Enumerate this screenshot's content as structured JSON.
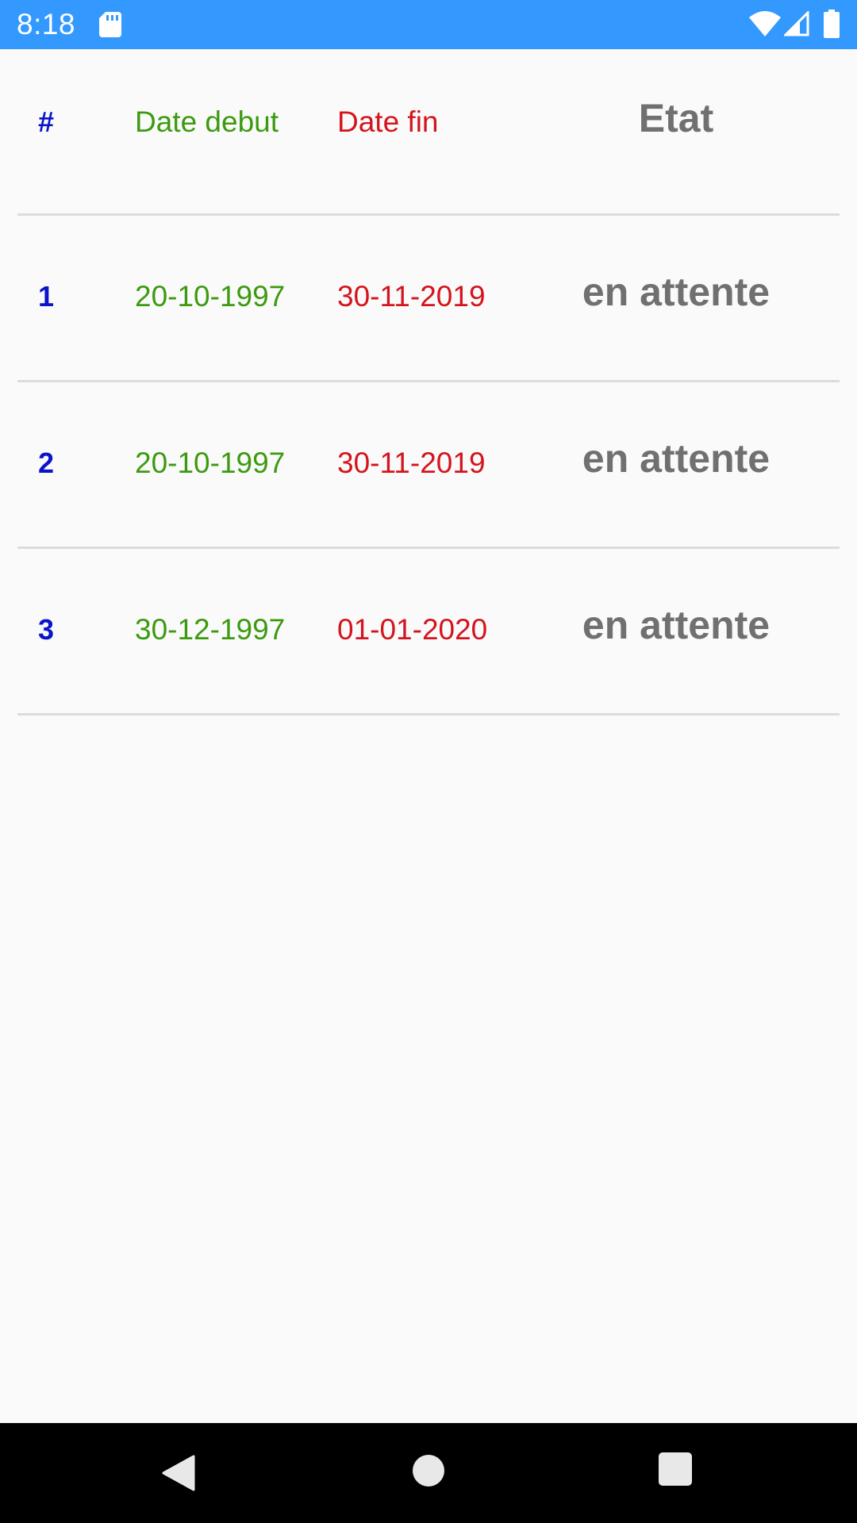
{
  "status_bar": {
    "time": "8:18",
    "background": "#3399ff",
    "icons": [
      "sd-card-icon",
      "wifi-icon",
      "signal-icon",
      "battery-icon"
    ]
  },
  "table": {
    "headers": {
      "num": "#",
      "start": "Date debut",
      "end": "Date fin",
      "state": "Etat"
    },
    "rows": [
      {
        "num": "1",
        "start": "20-10-1997",
        "end": "30-11-2019",
        "state": "en attente"
      },
      {
        "num": "2",
        "start": "20-10-1997",
        "end": "30-11-2019",
        "state": "en attente"
      },
      {
        "num": "3",
        "start": "30-12-1997",
        "end": "01-01-2020",
        "state": "en attente"
      }
    ],
    "colors": {
      "num": "#0a14c8",
      "start": "#3c9a0f",
      "end": "#d4141c",
      "state": "#707070",
      "divider": "#dcdcdc"
    }
  },
  "nav_bar": {
    "icons": [
      "back-icon",
      "home-icon",
      "recents-icon"
    ]
  }
}
